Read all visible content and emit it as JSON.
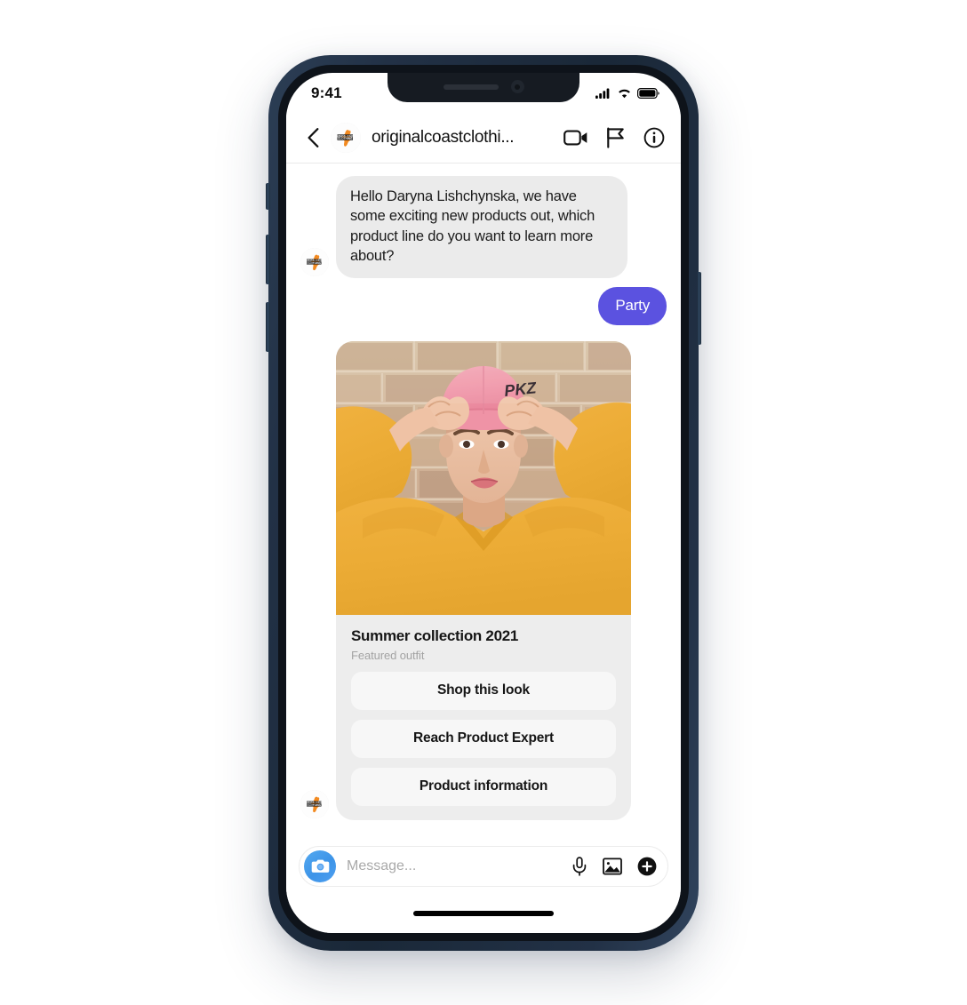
{
  "status_bar": {
    "time": "9:41",
    "icons": [
      "cellular-signal-icon",
      "wifi-icon",
      "battery-icon"
    ]
  },
  "header": {
    "back_icon": "chevron-left-icon",
    "avatar_name": "original-coast-clothing-avatar",
    "title": "originalcoastclothi...",
    "actions": [
      {
        "name": "video-call-icon",
        "label": "Video call"
      },
      {
        "name": "flag-icon",
        "label": "Report"
      },
      {
        "name": "info-icon",
        "label": "Info"
      }
    ]
  },
  "conversation": [
    {
      "direction": "incoming",
      "text": "Hello Daryna Lishchynska, we have some exciting new products out, which product line do you want to learn more about?"
    },
    {
      "direction": "outgoing",
      "text": "Party"
    }
  ],
  "product_card": {
    "image_alt": "Model in yellow sweatshirt and pink cap against brick wall",
    "title": "Summer collection 2021",
    "subtitle": "Featured outfit",
    "buttons": [
      "Shop this look",
      "Reach Product Expert",
      "Product information"
    ]
  },
  "input_bar": {
    "camera_icon": "camera-icon",
    "message_value": "",
    "message_placeholder": "Message...",
    "icons": [
      "microphone-icon",
      "photo-library-icon",
      "plus-circle-icon"
    ]
  },
  "brand": {
    "logo_line1": "ORIGINAL COAST",
    "logo_line2": "CLOTHING"
  },
  "colors": {
    "outgoing_bubble": "#5b52e0",
    "incoming_bubble": "#ebebeb",
    "card_bg": "#ededed",
    "card_button_bg": "#f7f7f7",
    "brand_orange": "#f28a21",
    "phone_frame": "#1f2e42",
    "camera_blue": "#3d94e8"
  }
}
